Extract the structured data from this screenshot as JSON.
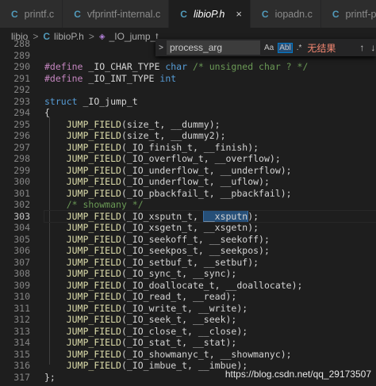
{
  "tabs": [
    {
      "label": "printf.c",
      "active": false
    },
    {
      "label": "vfprintf-internal.c",
      "active": false
    },
    {
      "label": "libioP.h",
      "active": true,
      "close": "×"
    },
    {
      "label": "iopadn.c",
      "active": false
    },
    {
      "label": "printf-parse.h",
      "active": false
    }
  ],
  "tab_icon_letter": "C",
  "breadcrumb": {
    "folder": "libio",
    "file": "libioP.h",
    "symbol": "_IO_jump_t",
    "separator": ">"
  },
  "find": {
    "query": "process_arg",
    "match_case": "Aa",
    "whole_word": "Abl",
    "regex": ".*",
    "result": "无结果",
    "prev": "↑",
    "next": "↓",
    "expand": ">"
  },
  "current_line": 303,
  "lines": [
    {
      "n": "288",
      "html": ""
    },
    {
      "n": "289",
      "html": ""
    },
    {
      "n": "290",
      "html": "<span class=\"kw\">#define</span> _IO_CHAR_TYPE <span class=\"type\">char</span> <span class=\"cm\">/* unsigned char ? */</span>"
    },
    {
      "n": "291",
      "html": "<span class=\"kw\">#define</span> _IO_INT_TYPE <span class=\"type\">int</span>"
    },
    {
      "n": "292",
      "html": ""
    },
    {
      "n": "293",
      "html": "<span class=\"type\">struct</span> _IO_jump_t"
    },
    {
      "n": "294",
      "html": "{"
    },
    {
      "n": "295",
      "html": "    <span class=\"fn\">JUMP_FIELD</span>(size_t, __dummy);"
    },
    {
      "n": "296",
      "html": "    <span class=\"fn\">JUMP_FIELD</span>(size_t, __dummy2);"
    },
    {
      "n": "297",
      "html": "    <span class=\"fn\">JUMP_FIELD</span>(_IO_finish_t, __finish);"
    },
    {
      "n": "298",
      "html": "    <span class=\"fn\">JUMP_FIELD</span>(_IO_overflow_t, __overflow);"
    },
    {
      "n": "299",
      "html": "    <span class=\"fn\">JUMP_FIELD</span>(_IO_underflow_t, __underflow);"
    },
    {
      "n": "300",
      "html": "    <span class=\"fn\">JUMP_FIELD</span>(_IO_underflow_t, __uflow);"
    },
    {
      "n": "301",
      "html": "    <span class=\"fn\">JUMP_FIELD</span>(_IO_pbackfail_t, __pbackfail);"
    },
    {
      "n": "302",
      "html": "    <span class=\"cm\">/* showmany */</span>"
    },
    {
      "n": "303",
      "html": "    <span class=\"fn\">JUMP_FIELD</span>(_IO_xsputn_t, <span class=\"hl\">__xsputn</span>);"
    },
    {
      "n": "304",
      "html": "    <span class=\"fn\">JUMP_FIELD</span>(_IO_xsgetn_t, __xsgetn);"
    },
    {
      "n": "305",
      "html": "    <span class=\"fn\">JUMP_FIELD</span>(_IO_seekoff_t, __seekoff);"
    },
    {
      "n": "306",
      "html": "    <span class=\"fn\">JUMP_FIELD</span>(_IO_seekpos_t, __seekpos);"
    },
    {
      "n": "307",
      "html": "    <span class=\"fn\">JUMP_FIELD</span>(_IO_setbuf_t, __setbuf);"
    },
    {
      "n": "308",
      "html": "    <span class=\"fn\">JUMP_FIELD</span>(_IO_sync_t, __sync);"
    },
    {
      "n": "309",
      "html": "    <span class=\"fn\">JUMP_FIELD</span>(_IO_doallocate_t, __doallocate);"
    },
    {
      "n": "310",
      "html": "    <span class=\"fn\">JUMP_FIELD</span>(_IO_read_t, __read);"
    },
    {
      "n": "311",
      "html": "    <span class=\"fn\">JUMP_FIELD</span>(_IO_write_t, __write);"
    },
    {
      "n": "312",
      "html": "    <span class=\"fn\">JUMP_FIELD</span>(_IO_seek_t, __seek);"
    },
    {
      "n": "313",
      "html": "    <span class=\"fn\">JUMP_FIELD</span>(_IO_close_t, __close);"
    },
    {
      "n": "314",
      "html": "    <span class=\"fn\">JUMP_FIELD</span>(_IO_stat_t, __stat);"
    },
    {
      "n": "315",
      "html": "    <span class=\"fn\">JUMP_FIELD</span>(_IO_showmanyc_t, __showmanyc);"
    },
    {
      "n": "316",
      "html": "    <span class=\"fn\">JUMP_FIELD</span>(_IO_imbue_t, __imbue);"
    },
    {
      "n": "317",
      "html": "};"
    }
  ],
  "watermark": "https://blog.csdn.net/qq_29173507",
  "colors": {
    "background": "#1e1e1e",
    "keyword": "#c586c0",
    "type": "#569cd6",
    "function": "#dcdcaa",
    "comment": "#6a9955",
    "no_results": "#f48771"
  }
}
